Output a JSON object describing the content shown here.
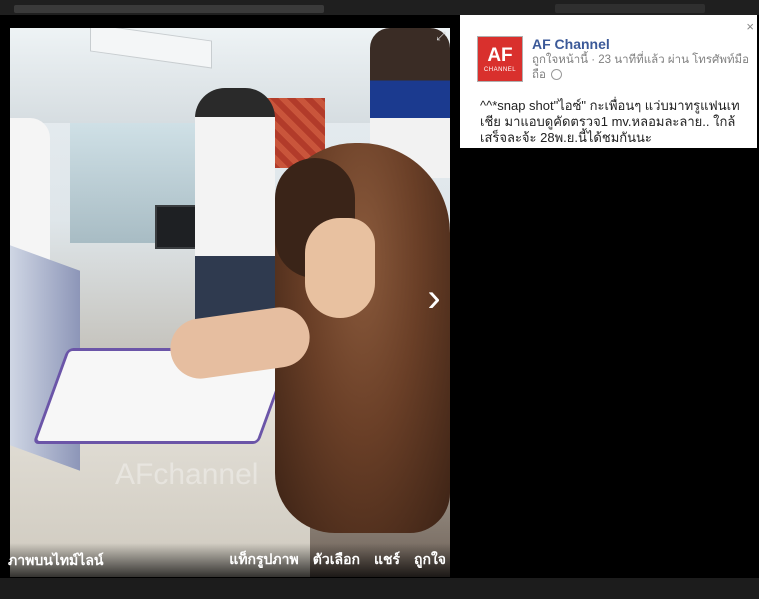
{
  "post": {
    "page_name": "AF Channel",
    "meta_liked_by": "ถูกใจหน้านี้",
    "meta_time": "23 นาทีที่แล้ว",
    "meta_via": "ผ่าน โทรศัพท์มือถือ",
    "text": "^^*snap shot\"ไอซ์\" กะเพื่อนๆ แว่บมาทรูแฟนเทเชีย มาแอบดูคัดตรวจ1 mv.หลอมละลาย.. ใกล้เสร็จละจ้ะ 28พ.ย.นี้ได้ชมกันนะ",
    "avatar": {
      "mark": "AF",
      "sub": "CHANNEL",
      "color": "#d9302d"
    }
  },
  "photo": {
    "watermark": "AFchannel"
  },
  "viewer": {
    "timeline_label": "ภาพบนไทม์ไลน์",
    "actions": {
      "tag": "แท็กรูปภาพ",
      "options": "ตัวเลือก",
      "share": "แชร์",
      "like": "ถูกใจ"
    },
    "close": "×",
    "next": "›",
    "expand": "⤢"
  },
  "colors": {
    "link": "#3b5998",
    "backdrop": "#000000"
  }
}
